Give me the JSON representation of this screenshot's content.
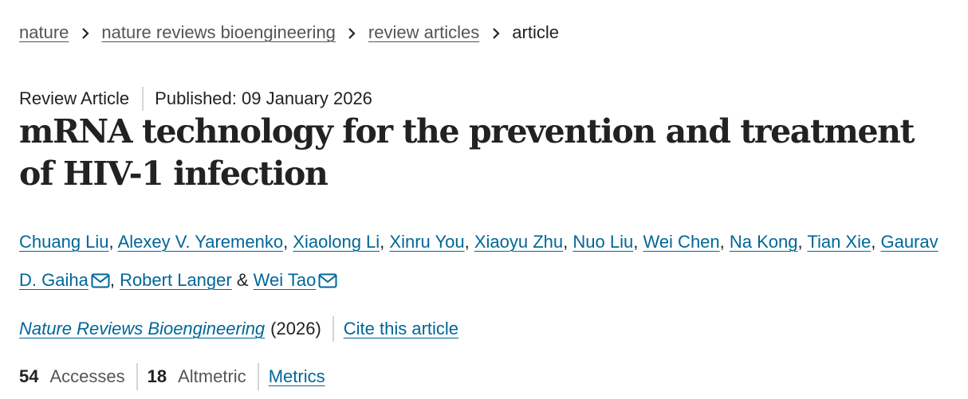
{
  "breadcrumb": {
    "items": [
      {
        "label": "nature"
      },
      {
        "label": "nature reviews bioengineering"
      },
      {
        "label": "review articles"
      }
    ],
    "current": "article"
  },
  "article": {
    "type": "Review Article",
    "published": "Published: 09 January 2026",
    "title": "mRNA technology for the prevention and treatment of HIV-1 infection"
  },
  "authors": {
    "names": [
      "Chuang Liu",
      "Alexey V. Yaremenko",
      "Xiaolong Li",
      "Xinru You",
      "Xiaoyu Zhu",
      "Nuo Liu",
      "Wei Chen",
      "Na Kong",
      "Tian Xie",
      "Gaurav D. Gaiha",
      "Robert Langer",
      "Wei Tao"
    ],
    "separator": ", ",
    "ampersand": " & "
  },
  "citation": {
    "journal": "Nature Reviews Bioengineering",
    "year": "(2026)",
    "cite_label": "Cite this article"
  },
  "metrics": {
    "accesses_count": "54",
    "accesses_label": "Accesses",
    "altmetric_count": "18",
    "altmetric_label": "Altmetric",
    "metrics_link": "Metrics"
  },
  "icons": {
    "mail": "envelope-icon",
    "chevron": "chevron-right-icon"
  },
  "colors": {
    "link": "#006699",
    "text": "#222222",
    "muted": "#555555",
    "separator": "#d5d5d5"
  }
}
